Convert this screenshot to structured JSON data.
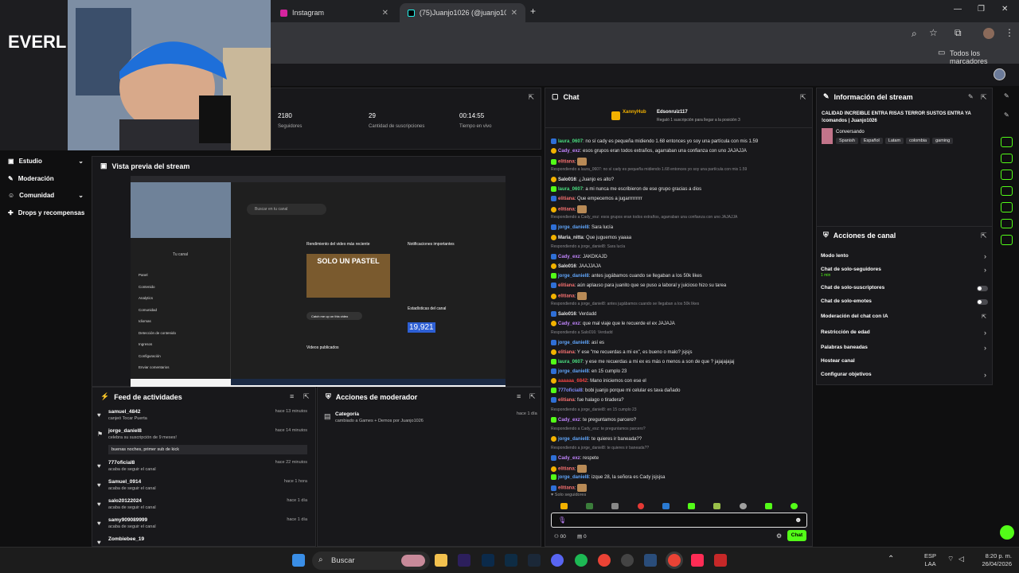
{
  "browser": {
    "tabs": [
      {
        "label": "Instagram"
      },
      {
        "label": "(75)Juanjo1026 (@juanjo1026_"
      }
    ],
    "bookmarks_label": "Todos los marcadores"
  },
  "sidebar": {
    "items": [
      {
        "label": "Estudio"
      },
      {
        "label": "Moderación"
      },
      {
        "label": "Comunidad"
      },
      {
        "label": "Drops y recompensas"
      }
    ]
  },
  "stats": {
    "followers": "2180",
    "followers_label": "Seguidores",
    "subs": "29",
    "subs_label": "Cantidad de suscripciones",
    "live": "00:14:55",
    "live_label": "Tiempo en vivo"
  },
  "preview": {
    "title": "Vista previa del stream",
    "search": "Buscar en tu canal",
    "channel_label": "Tu canal",
    "video_title": "Rendimiento del video más reciente",
    "thumb_text": "SOLO UN PASTEL",
    "notif_title": "Notificaciones importantes",
    "stats_title": "Estadísticas del canal",
    "subs_current": "19,921",
    "menu": [
      "Panel",
      "Contenido",
      "Analytics",
      "Comunidad",
      "Idiomas",
      "Detección de contenido",
      "Ingresos",
      "Configuración",
      "Enviar comentarios"
    ],
    "videos_title": "Videos publicados",
    "catch_btn": "Catch me up on this video"
  },
  "activity": {
    "title": "Feed de actividades",
    "items": [
      {
        "user": "samuel_4842",
        "desc": "canjeó Tocar Puerta",
        "time": "hace 13 minutos"
      },
      {
        "user": "jorge_daniel8",
        "desc": "celebra su suscripción de 9 meses!",
        "msg": "buenas noches, primer sub de kick",
        "time": "hace 14 minutos"
      },
      {
        "user": "777oficial8",
        "desc": "acaba de seguir el canal",
        "time": "hace 22 minutos"
      },
      {
        "user": "Samuel_0914",
        "desc": "acaba de seguir el canal",
        "time": "hace 1 hora"
      },
      {
        "user": "salo20122024",
        "desc": "acaba de seguir el canal",
        "time": "hace 1 día"
      },
      {
        "user": "samy909089999",
        "desc": "acaba de seguir el canal",
        "time": "hace 1 día"
      },
      {
        "user": "Zombiebee_19",
        "desc": "",
        "time": ""
      }
    ]
  },
  "mod": {
    "title": "Acciones de moderador",
    "category_label": "Categoría",
    "category_desc": "cambiado a Games + Demos por Juanjo1026",
    "time": "hace 1 día"
  },
  "chat": {
    "title": "Chat",
    "pinned_user": "XannyHub",
    "pinned_user2": "Edsonruiz117",
    "pinned_desc": "Regaló 1 suscripción para llegar a la posición 3",
    "followers_only": "Solo seguidores",
    "send": "Chat",
    "counter_left": "00",
    "counter_mid": "0",
    "lines": [
      {
        "u": "laura_0607",
        "c": "#4ade80",
        "t": "no sí cady es pequeña midiendo 1.68 entonces yo soy una partícula con mis 1.59"
      },
      {
        "u": "Cady_exz",
        "c": "#c084fc",
        "t": "esos grupos eran todos extraños, agarraban una confianza con uno JAJAJJA"
      },
      {
        "u": "elitiana",
        "c": "#f87171",
        "t": ""
      },
      {
        "r": "Respondiendo a laura_0607: no sí cady es pequeña midiendo 1.68 entonces yo soy una partícula con mis 1.59"
      },
      {
        "u": "Salo016",
        "c": "#e5e5e5",
        "t": "¿Juanjo es alto?"
      },
      {
        "u": "laura_0607",
        "c": "#4ade80",
        "t": "a mi nunca me escribieron de ese grupo gracias a dios"
      },
      {
        "u": "elitiana",
        "c": "#f87171",
        "t": "Que empecemos a jugarrrrrrrrr"
      },
      {
        "u": "elitiana",
        "c": "#f87171",
        "t": ""
      },
      {
        "r": "Respondiendo a Cady_exz: esos grupos eran todos extraños, agarraban una confianza con uno JAJAJJA"
      },
      {
        "u": "jorge_daniel8",
        "c": "#60a5fa",
        "t": "Sara lucía"
      },
      {
        "u": "Maria_nitta",
        "c": "#e5e5e5",
        "t": "Que juguemos yaaaa"
      },
      {
        "r": "Respondiendo a jorge_daniel8: Sara lucía"
      },
      {
        "u": "Cady_exz",
        "c": "#c084fc",
        "t": "JAKDKAJD"
      },
      {
        "u": "Salo016",
        "c": "#e5e5e5",
        "t": "JAAJJAJA"
      },
      {
        "u": "jorge_daniel8",
        "c": "#60a5fa",
        "t": "antes jugábamos cuando se llegaban a los 50k likes"
      },
      {
        "u": "elitiana",
        "c": "#f87171",
        "t": "aún aplauso para juanito que se puso a laboral y juicioso hizo su tarea"
      },
      {
        "u": "elitiana",
        "c": "#f87171",
        "t": ""
      },
      {
        "r": "Respondiendo a jorge_daniel8: antes jugábamos cuando se llegaban a los 50k likes"
      },
      {
        "u": "Salo016",
        "c": "#e5e5e5",
        "t": "Verdadd"
      },
      {
        "u": "Cady_exz",
        "c": "#c084fc",
        "t": "que mal viaje que le recuerde el ex JAJAJA"
      },
      {
        "r": "Respondiendo a Salo016: Verdadd"
      },
      {
        "u": "jorge_daniel8",
        "c": "#60a5fa",
        "t": "así es"
      },
      {
        "u": "elitiana",
        "c": "#f87171",
        "t": "Y ese \"me recuerdas a mi ex\", es bueno o malo? jsjsjs"
      },
      {
        "u": "laura_0607",
        "c": "#4ade80",
        "t": "y ese me recuerdas a mi ex es más o menos a son de que ? jajajajajaj"
      },
      {
        "u": "jorge_daniel8",
        "c": "#60a5fa",
        "t": "en 15 cumplo 23"
      },
      {
        "u": "aaaaaa_6842",
        "c": "#ef4444",
        "t": "Mano iniciemos con ese el"
      },
      {
        "u": "777oficial8",
        "c": "#818cf8",
        "t": "bobi juanjo porque mi celular es tava dañado"
      },
      {
        "u": "elitiana",
        "c": "#f87171",
        "t": "fue halago o tiradera?"
      },
      {
        "r": "Respondiendo a jorge_daniel8: en 15 cumplo 23"
      },
      {
        "u": "Cady_exz",
        "c": "#c084fc",
        "t": "te preguntamos parcero?"
      },
      {
        "r": "Respondiendo a Cady_exz: te preguntamos parcero?"
      },
      {
        "u": "jorge_daniel8",
        "c": "#60a5fa",
        "t": "te quieres ir baneada??"
      },
      {
        "r": "Respondiendo a jorge_daniel8: te quieres ir baneada??"
      },
      {
        "u": "Cady_exz",
        "c": "#c084fc",
        "t": "respete"
      },
      {
        "u": "elitiana",
        "c": "#f87171",
        "t": ""
      },
      {
        "u": "jorge_daniel8",
        "c": "#60a5fa",
        "t": "izque 28, la señora es Cady jsjsjsa"
      },
      {
        "u": "elitiana",
        "c": "#f87171",
        "t": ""
      }
    ]
  },
  "info": {
    "title": "Información del stream",
    "stream_title": "CALIDAD INCREIBLE ENTRA RISAS TERROR SUSTOS ENTRA YA !comandos | Juanjo1026",
    "category": "Conversando",
    "tags": [
      "Spanish",
      "Español",
      "Latam",
      "colombia",
      "gaming"
    ]
  },
  "channel_actions": {
    "title": "Acciones de canal",
    "items": [
      {
        "label": "Modo lento",
        "type": "chevron"
      },
      {
        "label": "Chat de solo-seguidores",
        "sub": "1 min",
        "type": "chevron"
      },
      {
        "label": "Chat de solo-suscriptores",
        "type": "toggle"
      },
      {
        "label": "Chat de solo-emotes",
        "type": "toggle"
      },
      {
        "label": "Moderación del chat con IA",
        "type": "link"
      },
      {
        "label": "Restricción de edad",
        "type": "chevron"
      },
      {
        "label": "Palabras baneadas",
        "type": "chevron"
      },
      {
        "label": "Hostear canal",
        "type": "none"
      },
      {
        "label": "Configurar objetivos",
        "type": "chevron"
      }
    ]
  },
  "taskbar": {
    "search": "Buscar",
    "lang": "ESP",
    "lang2": "LAA",
    "time": "8:20 p. m.",
    "date": "26/04/2026"
  },
  "colors": {
    "accent": "#53fc18",
    "panel": "#18181b"
  }
}
